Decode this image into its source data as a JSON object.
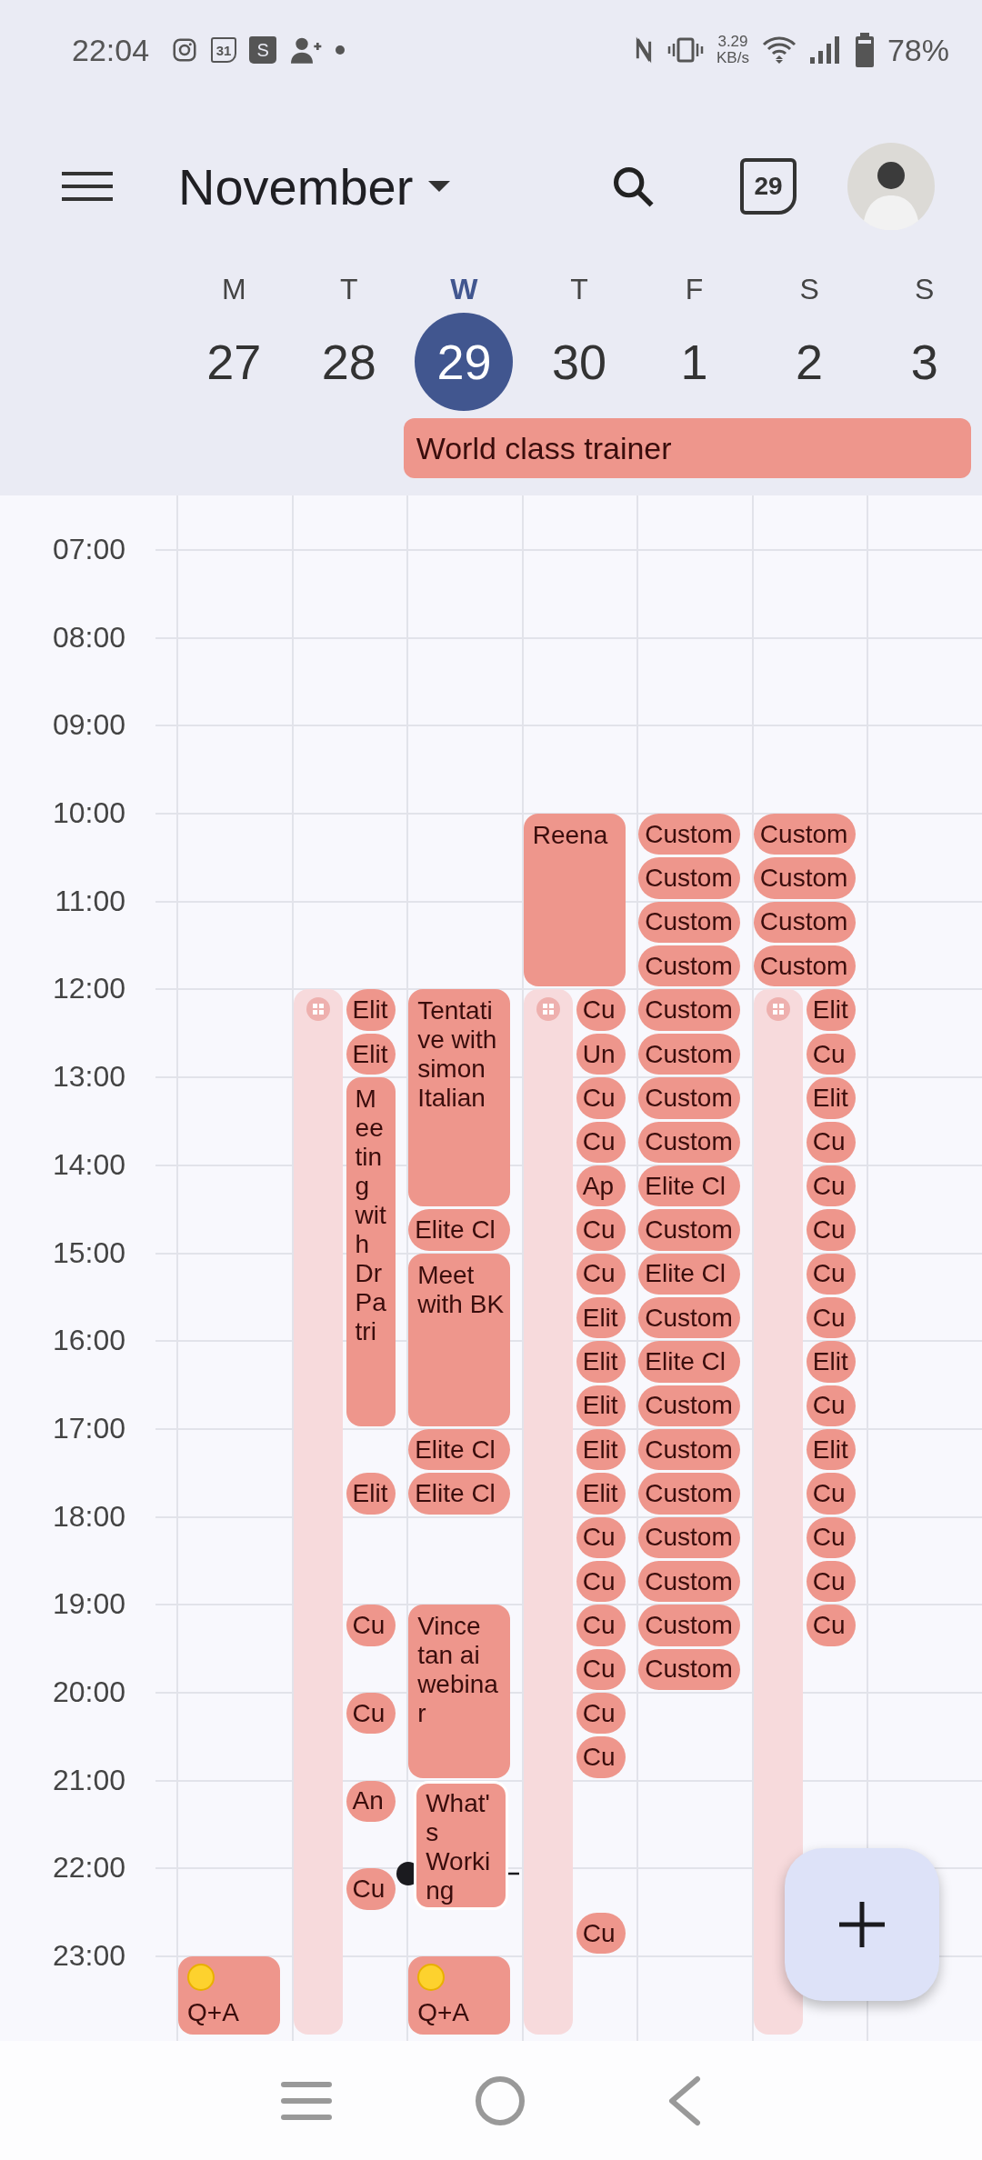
{
  "status_bar": {
    "time": "22:04",
    "calendar_badge": "31",
    "shop_badge": "S",
    "speed_value": "3.29",
    "speed_unit": "KB/s",
    "battery": "78%"
  },
  "top_bar": {
    "month": "November",
    "today_label": "29"
  },
  "days": [
    {
      "letter": "M",
      "number": "27",
      "selected": false,
      "events": [
        {
          "kind": "event",
          "title": "Q+A",
          "dot": true
        }
      ]
    },
    {
      "letter": "T",
      "number": "28",
      "selected": false,
      "events": [
        {
          "kind": "busy"
        },
        {
          "kind": "event",
          "title": "Elit"
        },
        {
          "kind": "event",
          "title": "Elit"
        },
        {
          "kind": "event",
          "title": "Meeting with Dr Patri"
        },
        {
          "kind": "event",
          "title": "Elit"
        },
        {
          "kind": "event",
          "title": "Cu"
        },
        {
          "kind": "event",
          "title": "Cu"
        },
        {
          "kind": "event",
          "title": "An"
        },
        {
          "kind": "event",
          "title": "Cu"
        }
      ]
    },
    {
      "letter": "W",
      "number": "29",
      "selected": true,
      "all_day": {
        "title": "World class trainer"
      },
      "now_line": true,
      "events": [
        {
          "kind": "event",
          "title": "Tentative with simon Italian"
        },
        {
          "kind": "event",
          "title": "Elite Cl"
        },
        {
          "kind": "event",
          "title": "Meet with BK"
        },
        {
          "kind": "event",
          "title": "Elite Cl"
        },
        {
          "kind": "event",
          "title": "Elite Cl"
        },
        {
          "kind": "event",
          "title": "Vince tan ai webinar"
        },
        {
          "kind": "stacked",
          "title": "What's Working"
        },
        {
          "kind": "event",
          "title": "Q+A",
          "dot": true
        }
      ]
    },
    {
      "letter": "T",
      "number": "30",
      "selected": false,
      "all_day_continues": true,
      "events": [
        {
          "kind": "event",
          "title": "Reena"
        },
        {
          "kind": "busy"
        },
        {
          "kind": "event",
          "title": "Cu"
        },
        {
          "kind": "event",
          "title": "Un"
        },
        {
          "kind": "event",
          "title": "Cu"
        },
        {
          "kind": "event",
          "title": "Cu"
        },
        {
          "kind": "event",
          "title": "Ap"
        },
        {
          "kind": "event",
          "title": "Cu"
        },
        {
          "kind": "event",
          "title": "Cu"
        },
        {
          "kind": "event",
          "title": "Elit"
        },
        {
          "kind": "event",
          "title": "Elit"
        },
        {
          "kind": "event",
          "title": "Elit"
        },
        {
          "kind": "event",
          "title": "Elit"
        },
        {
          "kind": "event",
          "title": "Elit"
        },
        {
          "kind": "event",
          "title": "Cu"
        },
        {
          "kind": "event",
          "title": "Cu"
        },
        {
          "kind": "event",
          "title": "Cu"
        },
        {
          "kind": "event",
          "title": "Cu"
        },
        {
          "kind": "event",
          "title": "Cu"
        },
        {
          "kind": "event",
          "title": "Cu"
        },
        {
          "kind": "event",
          "title": "Cu"
        }
      ]
    },
    {
      "letter": "F",
      "number": "1",
      "selected": false,
      "all_day_continues": true,
      "events": [
        {
          "kind": "event",
          "title": "Custom"
        },
        {
          "kind": "event",
          "title": "Custom"
        },
        {
          "kind": "event",
          "title": "Custom"
        },
        {
          "kind": "event",
          "title": "Custom"
        },
        {
          "kind": "event",
          "title": "Custom"
        },
        {
          "kind": "event",
          "title": "Custom"
        },
        {
          "kind": "event",
          "title": "Custom"
        },
        {
          "kind": "event",
          "title": "Custom"
        },
        {
          "kind": "event",
          "title": "Elite Cl"
        },
        {
          "kind": "event",
          "title": "Custom"
        },
        {
          "kind": "event",
          "title": "Elite Cl"
        },
        {
          "kind": "event",
          "title": "Custom"
        },
        {
          "kind": "event",
          "title": "Elite Cl"
        },
        {
          "kind": "event",
          "title": "Custom"
        },
        {
          "kind": "event",
          "title": "Custom"
        },
        {
          "kind": "event",
          "title": "Custom"
        },
        {
          "kind": "event",
          "title": "Custom"
        },
        {
          "kind": "event",
          "title": "Custom"
        },
        {
          "kind": "event",
          "title": "Custom"
        },
        {
          "kind": "event",
          "title": "Custom"
        }
      ]
    },
    {
      "letter": "S",
      "number": "2",
      "selected": false,
      "all_day_continues": true,
      "events": [
        {
          "kind": "event",
          "title": "Custom"
        },
        {
          "kind": "event",
          "title": "Custom"
        },
        {
          "kind": "event",
          "title": "Custom"
        },
        {
          "kind": "event",
          "title": "Custom"
        },
        {
          "kind": "busy"
        },
        {
          "kind": "event",
          "title": "Elit"
        },
        {
          "kind": "event",
          "title": "Cu"
        },
        {
          "kind": "event",
          "title": "Elit"
        },
        {
          "kind": "event",
          "title": "Cu"
        },
        {
          "kind": "event",
          "title": "Cu"
        },
        {
          "kind": "event",
          "title": "Cu"
        },
        {
          "kind": "event",
          "title": "Cu"
        },
        {
          "kind": "event",
          "title": "Cu"
        },
        {
          "kind": "event",
          "title": "Elit"
        },
        {
          "kind": "event",
          "title": "Cu"
        },
        {
          "kind": "event",
          "title": "Elit"
        },
        {
          "kind": "event",
          "title": "Cu"
        },
        {
          "kind": "event",
          "title": "Cu"
        },
        {
          "kind": "event",
          "title": "Cu"
        },
        {
          "kind": "event",
          "title": "Cu"
        }
      ]
    },
    {
      "letter": "S",
      "number": "3",
      "selected": false,
      "all_day_continues": true
    }
  ],
  "time_labels": [
    "07:00",
    "08:00",
    "09:00",
    "10:00",
    "11:00",
    "12:00",
    "13:00",
    "14:00",
    "15:00",
    "16:00",
    "17:00",
    "18:00",
    "19:00",
    "20:00",
    "21:00",
    "22:00",
    "23:00"
  ]
}
